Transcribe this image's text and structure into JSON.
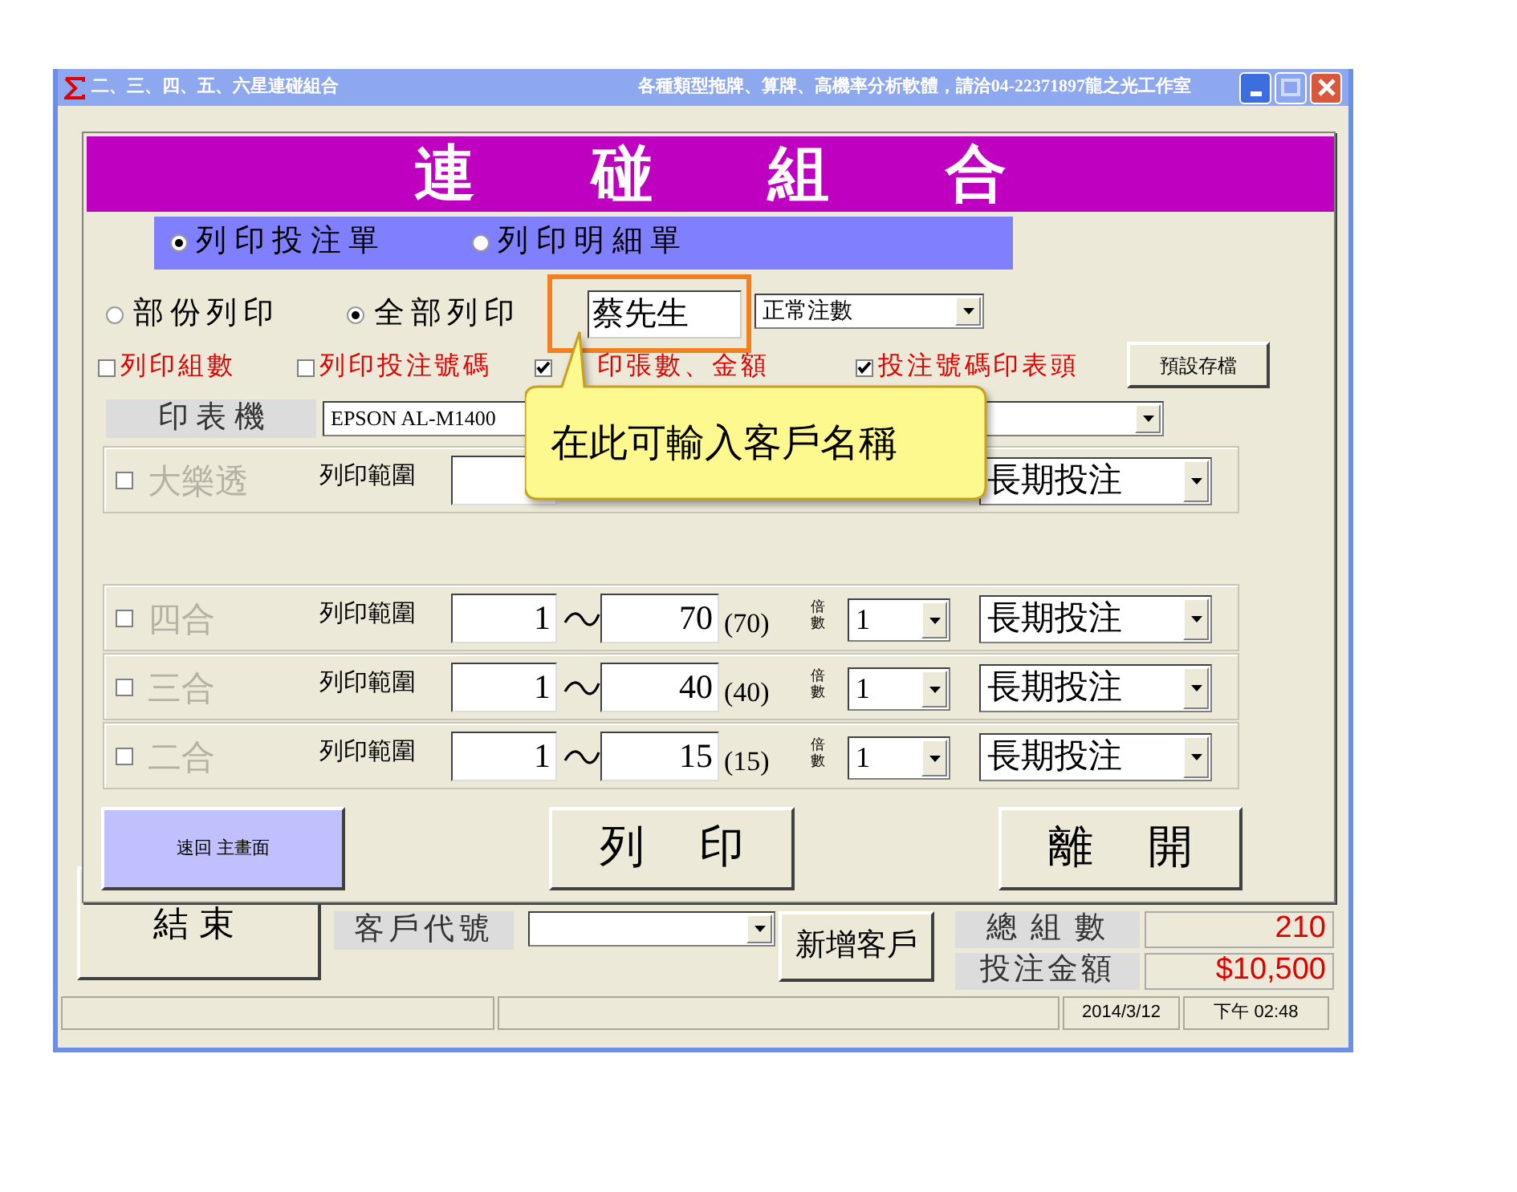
{
  "window": {
    "title": "二、三、四、五、六星連碰組合",
    "subtitle": "各種類型拖牌、算牌、高機率分析軟體，請洽04-22371897龍之光工作室"
  },
  "main": {
    "end_button": "結束",
    "customer_code_label": "客戶代號",
    "add_customer": "新增客戶",
    "totals": [
      {
        "label": "總 組 數",
        "value": "210"
      },
      {
        "label": "投注金額",
        "value": "$10,500"
      }
    ]
  },
  "status_bar": {
    "date": "2014/3/12",
    "time": "下午 02:48"
  },
  "dialog": {
    "header": "連碰組合",
    "print_modes": [
      {
        "label": "列 印 投 注 單",
        "selected": true
      },
      {
        "label": "列 印 明 細 單",
        "selected": false
      }
    ],
    "scope": [
      {
        "label": "部份列印",
        "selected": false
      },
      {
        "label": "全部列印",
        "selected": true
      }
    ],
    "customer_name": {
      "value": "蔡先生",
      "highlighted": true
    },
    "count_mode": "正常注數",
    "options": [
      {
        "label": "列印組數",
        "checked": false
      },
      {
        "label": "列印投注號碼",
        "checked": false
      },
      {
        "label": "印張數、金額",
        "checked": true
      },
      {
        "label": "投注號碼印表頭",
        "checked": true
      }
    ],
    "save_defaults": "預設存檔",
    "printer": {
      "label": "印 表 機",
      "value": "EPSON AL-M1400"
    },
    "callout": "在此可輸入客戶名稱",
    "games": [
      {
        "name": "大樂透",
        "checked": false,
        "disabled": true,
        "range_label": "列印範圍",
        "mode": "長期投注"
      },
      {
        "name": "四合",
        "checked": false,
        "disabled": true,
        "range_label": "列印範圍",
        "from": "1",
        "to": "70",
        "total": "(70)",
        "multiplier_label": "倍數",
        "multiplier": "1",
        "mode": "長期投注"
      },
      {
        "name": "三合",
        "checked": false,
        "disabled": true,
        "range_label": "列印範圍",
        "from": "1",
        "to": "40",
        "total": "(40)",
        "multiplier_label": "倍數",
        "multiplier": "1",
        "mode": "長期投注"
      },
      {
        "name": "二合",
        "checked": false,
        "disabled": true,
        "range_label": "列印範圍",
        "from": "1",
        "to": "15",
        "total": "(15)",
        "multiplier_label": "倍數",
        "multiplier": "1",
        "mode": "長期投注"
      }
    ],
    "buttons": {
      "back": "速回 主畫面",
      "print": "列印",
      "exit": "離開"
    }
  }
}
